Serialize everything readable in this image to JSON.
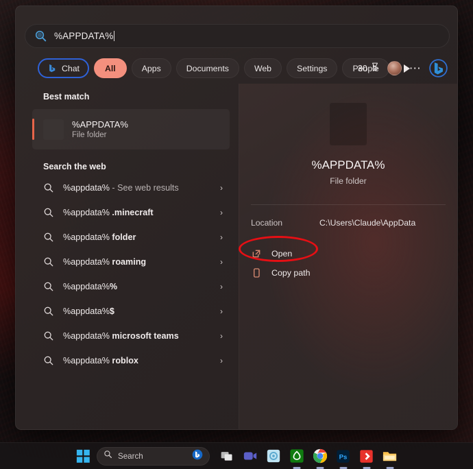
{
  "search": {
    "query": "%APPDATA%",
    "icon": "search-icon"
  },
  "filters": {
    "items": [
      {
        "label": "Chat",
        "state": "outlined",
        "icon": "bing-chat-icon"
      },
      {
        "label": "All",
        "state": "selected"
      },
      {
        "label": "Apps",
        "state": "normal"
      },
      {
        "label": "Documents",
        "state": "normal"
      },
      {
        "label": "Web",
        "state": "normal"
      },
      {
        "label": "Settings",
        "state": "normal"
      },
      {
        "label": "People",
        "state": "normal"
      }
    ],
    "more_icon": "play-arrow-icon",
    "rewards_count": "30",
    "rewards_icon": "rewards-medal-icon",
    "avatar": "user-avatar",
    "overflow_icon": "more-options-icon",
    "bing_icon": "bing-logo-icon"
  },
  "results": {
    "best_match_header": "Best match",
    "best_match": {
      "title": "%APPDATA%",
      "subtitle": "File folder",
      "icon": "folder-icon"
    },
    "web_header": "Search the web",
    "web_items": [
      {
        "term": "%appdata%",
        "suffix": " - See web results",
        "suffix_style": "muted"
      },
      {
        "term": "%appdata%",
        "suffix": " .minecraft",
        "suffix_style": "bold"
      },
      {
        "term": "%appdata%",
        "suffix": " folder",
        "suffix_style": "bold"
      },
      {
        "term": "%appdata%",
        "suffix": " roaming",
        "suffix_style": "bold"
      },
      {
        "term": "%appdata%",
        "suffix": "%",
        "suffix_style": "bold"
      },
      {
        "term": "%appdata%",
        "suffix": "$",
        "suffix_style": "bold"
      },
      {
        "term": "%appdata%",
        "suffix": " microsoft teams",
        "suffix_style": "bold"
      },
      {
        "term": "%appdata%",
        "suffix": " roblox",
        "suffix_style": "bold"
      }
    ],
    "chevron": "›"
  },
  "detail": {
    "title": "%APPDATA%",
    "subtitle": "File folder",
    "location_label": "Location",
    "location_value": "C:\\Users\\Claude\\AppData",
    "actions": [
      {
        "label": "Open",
        "icon": "open-external-icon",
        "highlighted": true
      },
      {
        "label": "Copy path",
        "icon": "copy-path-icon",
        "highlighted": false
      }
    ]
  },
  "annotation": {
    "shape": "ellipse",
    "color": "#e60f14",
    "targets": "Open"
  },
  "taskbar": {
    "start_icon": "windows-start-icon",
    "search_placeholder": "Search",
    "search_icon": "search-icon",
    "search_bing_icon": "bing-logo-icon",
    "apps": [
      {
        "name": "task-view-icon"
      },
      {
        "name": "teams-icon"
      },
      {
        "name": "widgets-icon"
      },
      {
        "name": "xbox-icon"
      },
      {
        "name": "chrome-icon"
      },
      {
        "name": "photoshop-icon"
      },
      {
        "name": "app-red-icon"
      },
      {
        "name": "file-explorer-icon"
      }
    ]
  },
  "theme": {
    "accent_orange": "#e8654a",
    "pill_selected": "#f4907e",
    "chat_outline": "#2f62d8",
    "annotation_red": "#e60f14"
  }
}
